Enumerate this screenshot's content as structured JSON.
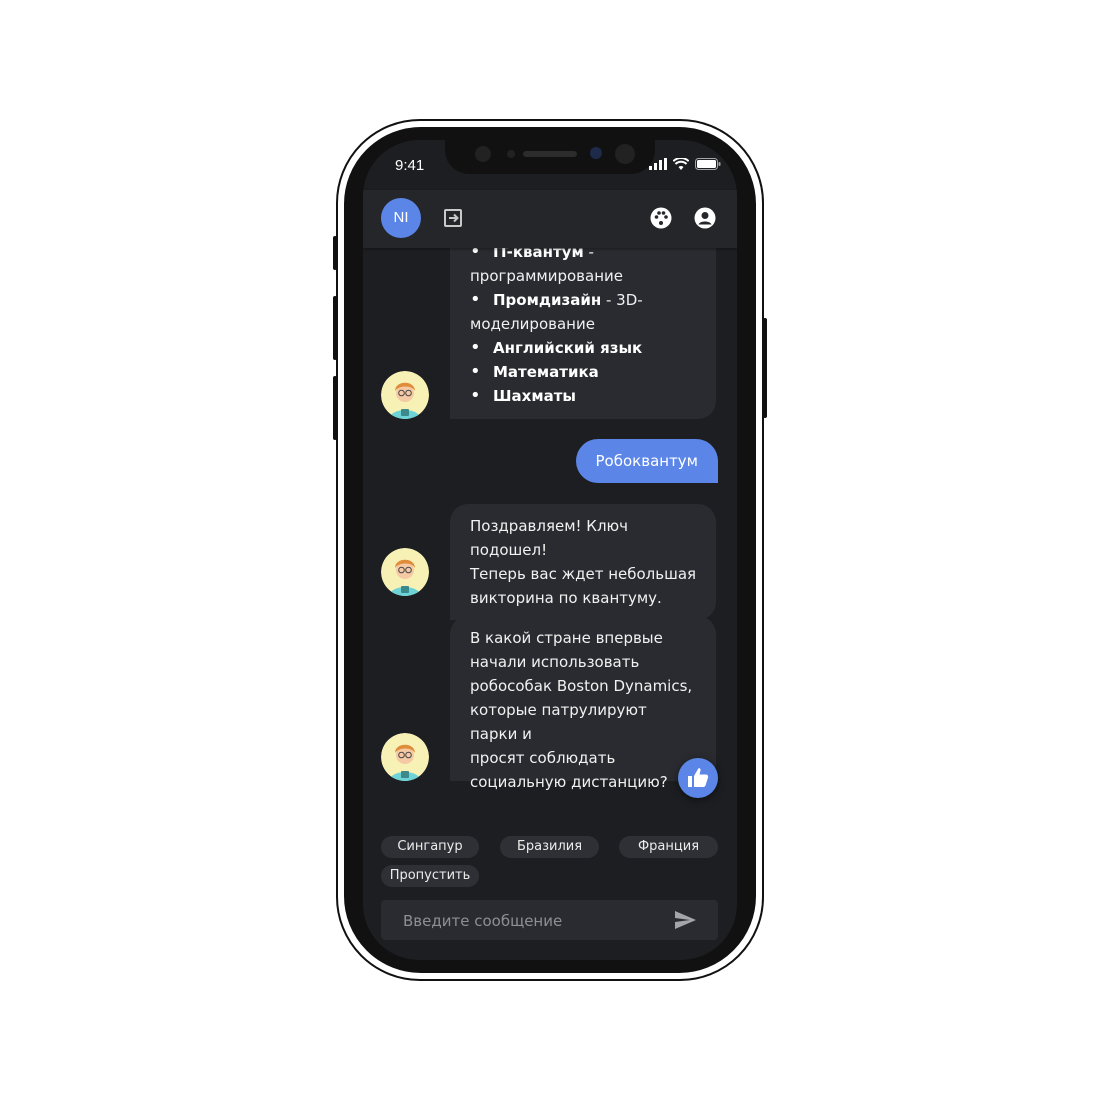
{
  "status_bar": {
    "time": "9:41"
  },
  "header": {
    "user_initials": "NI"
  },
  "messages": {
    "list_items": [
      {
        "bold": "IT-квантум",
        "rest": " -",
        "cont": "программирование"
      },
      {
        "bold": "Промдизайн",
        "rest": " - 3D-",
        "cont": "моделирование"
      },
      {
        "bold": "Английский язык",
        "rest": "",
        "cont": ""
      },
      {
        "bold": "Математика",
        "rest": "",
        "cont": ""
      },
      {
        "bold": "Шахматы",
        "rest": "",
        "cont": ""
      }
    ],
    "user_reply": "Робоквантум",
    "bot_congrats": [
      "Поздравляем! Ключ подошел!",
      "Теперь вас ждет небольшая",
      "викторина по квантуму."
    ],
    "bot_question": [
      "В какой стране впервые",
      "начали использовать",
      "робособак Boston Dynamics,",
      "которые патрулируют парки и",
      "просят соблюдать",
      "социальную дистанцию?"
    ]
  },
  "quick_replies": [
    "Сингапур",
    "Бразилия",
    "Франция",
    "Пропустить"
  ],
  "composer": {
    "placeholder": "Введите сообщение"
  },
  "colors": {
    "accent": "#5b86e8",
    "background": "#1d1e21",
    "bubble": "#2a2b30"
  },
  "icons": [
    "logout-icon",
    "palette-icon",
    "account-icon",
    "thumb-up-icon",
    "send-icon",
    "signal-icon",
    "wifi-icon",
    "battery-icon"
  ]
}
